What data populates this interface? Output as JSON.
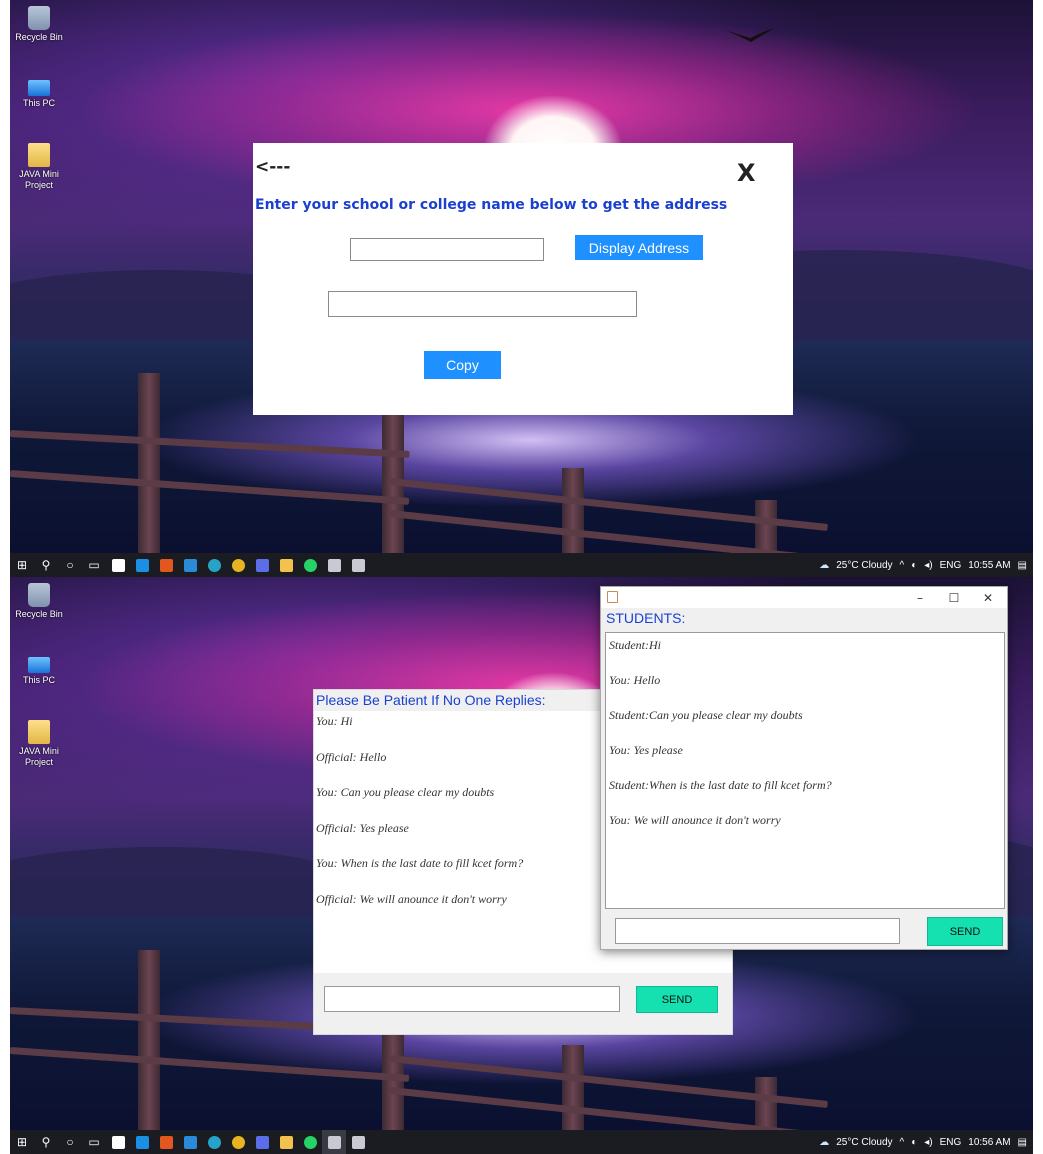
{
  "desktop": {
    "icons": [
      {
        "label": "Recycle Bin"
      },
      {
        "label": "This PC"
      },
      {
        "label": "JAVA Mini Project"
      }
    ]
  },
  "address_window": {
    "back_label": "<---",
    "close_label": "X",
    "heading": "Enter your school or college name below to get the address",
    "name_input_value": "",
    "display_button": "Display Address",
    "address_output_value": "",
    "copy_button": "Copy"
  },
  "chat_window": {
    "heading": "Please Be Patient If No One Replies:",
    "messages": [
      "You: Hi",
      "Official: Hello",
      "You: Can you please clear my doubts",
      "Official: Yes please",
      "You: When is the last date to fill kcet form?",
      "Official: We will anounce it don't worry"
    ],
    "input_value": "",
    "send_button": "SEND"
  },
  "students_window": {
    "heading": "STUDENTS:",
    "minimize": "–",
    "maximize": "☐",
    "close": "✕",
    "messages": [
      "Student:Hi",
      "You: Hello",
      "Student:Can you please clear my doubts",
      "You: Yes please",
      "Student:When is the last date to fill kcet form?",
      "You: We will anounce it don't worry"
    ],
    "input_value": "",
    "send_button": "SEND"
  },
  "taskbars": [
    {
      "weather": "25°C  Cloudy",
      "language": "ENG",
      "time": "10:55 AM"
    },
    {
      "weather": "25°C  Cloudy",
      "language": "ENG",
      "time": "10:56 AM"
    }
  ],
  "taskbar_icons": [
    "start-icon",
    "search-icon",
    "cortana-icon",
    "task-view-icon",
    "store-icon",
    "mail-icon",
    "office-icon",
    "vscode-icon",
    "edge-icon",
    "chrome-icon",
    "app-icon",
    "file-explorer-icon",
    "whatsapp-icon",
    "java-app-icon",
    "java-app-icon-2"
  ],
  "colors": {
    "accent_blue": "#1e90ff",
    "heading_blue": "#1a3fd1",
    "send_teal": "#14e0b0",
    "taskbar": "#1b1b22"
  }
}
